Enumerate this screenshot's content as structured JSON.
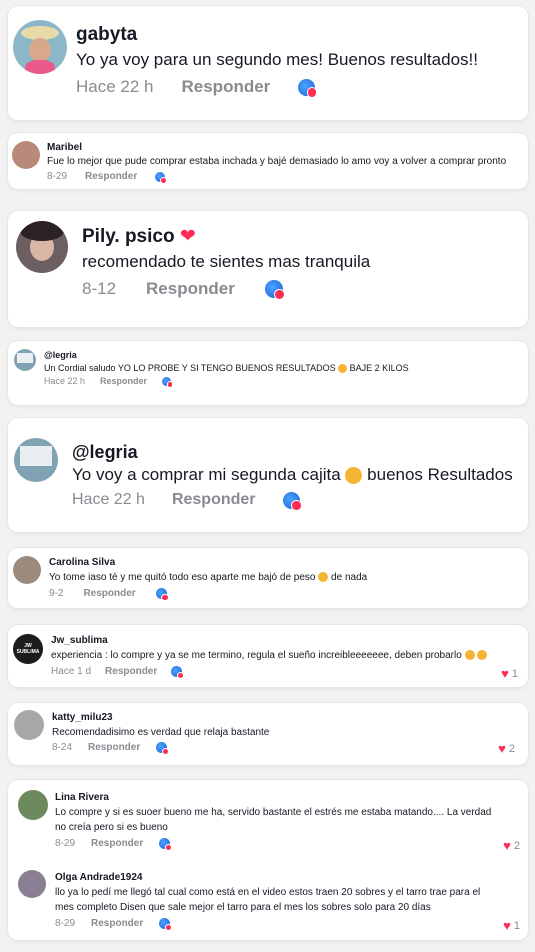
{
  "comments": [
    {
      "username": "gabyta",
      "text": "Yo ya voy para un segundo mes! Buenos resultados!!",
      "time": "Hace 22 h",
      "reply": "Responder",
      "avatar_color": "#8bb7c9"
    },
    {
      "username": "Maribel",
      "text": "Fue lo mejor que pude comprar estaba inchada y bajé demasiado lo amo voy a volver a comprar pronto",
      "time": "8-29",
      "reply": "Responder",
      "avatar_color": "#b88a7a"
    },
    {
      "username": "Pily. psico",
      "username_heart": "❤",
      "text": "recomendado te sientes mas tranquila",
      "time": "8-12",
      "reply": "Responder",
      "avatar_color": "#6b5f62"
    },
    {
      "username": "@legria",
      "text": "Un Cordial saludo YO LO PROBE Y SI TENGO BUENOS RESULTADOS",
      "text_after_emoji": "BAJE 2 KILOS",
      "time": "Hace 22 h",
      "reply": "Responder",
      "avatar_color": "#7fa3b2"
    },
    {
      "username": "@legria",
      "text": "Yo voy a comprar mi segunda cajita",
      "text_after_emoji": "buenos Resultados",
      "time": "Hace 22 h",
      "reply": "Responder",
      "avatar_color": "#7fa3b2"
    },
    {
      "username": "Carolina Silva",
      "text": "Yo tome iaso té y me quitó todo eso aparte me bajó de peso",
      "text_after_emoji": "de nada",
      "time": "9-2",
      "reply": "Responder",
      "avatar_color": "#9c8a7c"
    },
    {
      "username": "Jw_sublima",
      "avatar_text": "JW SUBLIMA",
      "text": "experiencia : lo compre y ya se me termino, regula el sueño increibleeeeeee, deben probarlo",
      "time": "Hace 1 d",
      "reply": "Responder",
      "likes": "1",
      "avatar_color": "#1c1c1c"
    },
    {
      "username": "katty_milu23",
      "text": "Recomendadisimo es verdad que relaja bastante",
      "time": "8-24",
      "reply": "Responder",
      "likes": "2",
      "avatar_color": "#a8a8a8"
    },
    {
      "username": "Lina Rivera",
      "text": "Lo compre y si es suoer bueno me ha, servido bastante el estrés me estaba matando.... La verdad",
      "text_line2": "no creía pero si es bueno",
      "time": "8-29",
      "reply": "Responder",
      "likes": "2",
      "avatar_color": "#6d8a5e"
    },
    {
      "username": "Olga Andrade1924",
      "text": "llo ya lo pedí me llegó tal cual como está en el video estos traen 20 sobres y el tarro trae para el",
      "text_line2": "mes completo Disen que sale mejor el tarro para el mes los sobres solo para 20 días",
      "time": "8-29",
      "reply": "Responder",
      "likes": "1",
      "avatar_color": "#8a7f95"
    }
  ],
  "icons": {
    "heart": "heart-icon",
    "badge": "super-badge-icon",
    "emoji": "smiley-emoji-icon"
  }
}
